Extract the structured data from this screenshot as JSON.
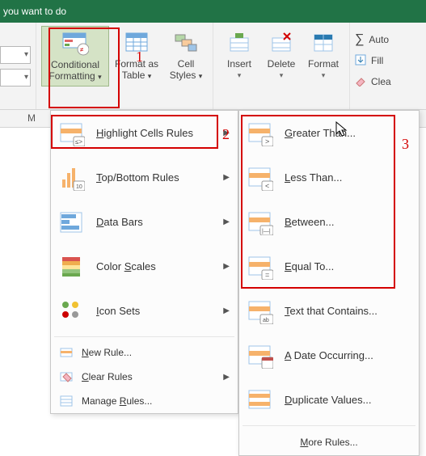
{
  "topbar": {
    "hint": "you want to do"
  },
  "ribbon": {
    "conditional_formatting": "Conditional Formatting",
    "format_as_table": "Format as Table",
    "cell_styles": "Cell Styles",
    "insert": "Insert",
    "delete": "Delete",
    "format": "Format",
    "autosum": "Auto",
    "fill": "Fill",
    "clear": "Clea"
  },
  "col_header": {
    "M": "M"
  },
  "menu1": {
    "highlight": "Highlight Cells Rules",
    "topbottom": "Top/Bottom Rules",
    "databars": "Data Bars",
    "colorscales": "Color Scales",
    "iconsets": "Icon Sets",
    "newrule": "New Rule...",
    "clearrules": "Clear Rules",
    "managerules": "Manage Rules..."
  },
  "menu2": {
    "greater": "Greater Than...",
    "less": "Less Than...",
    "between": "Between...",
    "equal": "Equal To...",
    "textcontains": "Text that Contains...",
    "dateoccurring": "A Date Occurring...",
    "duplicate": "Duplicate Values...",
    "morerules": "More Rules..."
  },
  "annotations": {
    "one": "1",
    "two": "2",
    "three": "3"
  },
  "colors": {
    "green": "#217346",
    "red": "#d40000"
  }
}
